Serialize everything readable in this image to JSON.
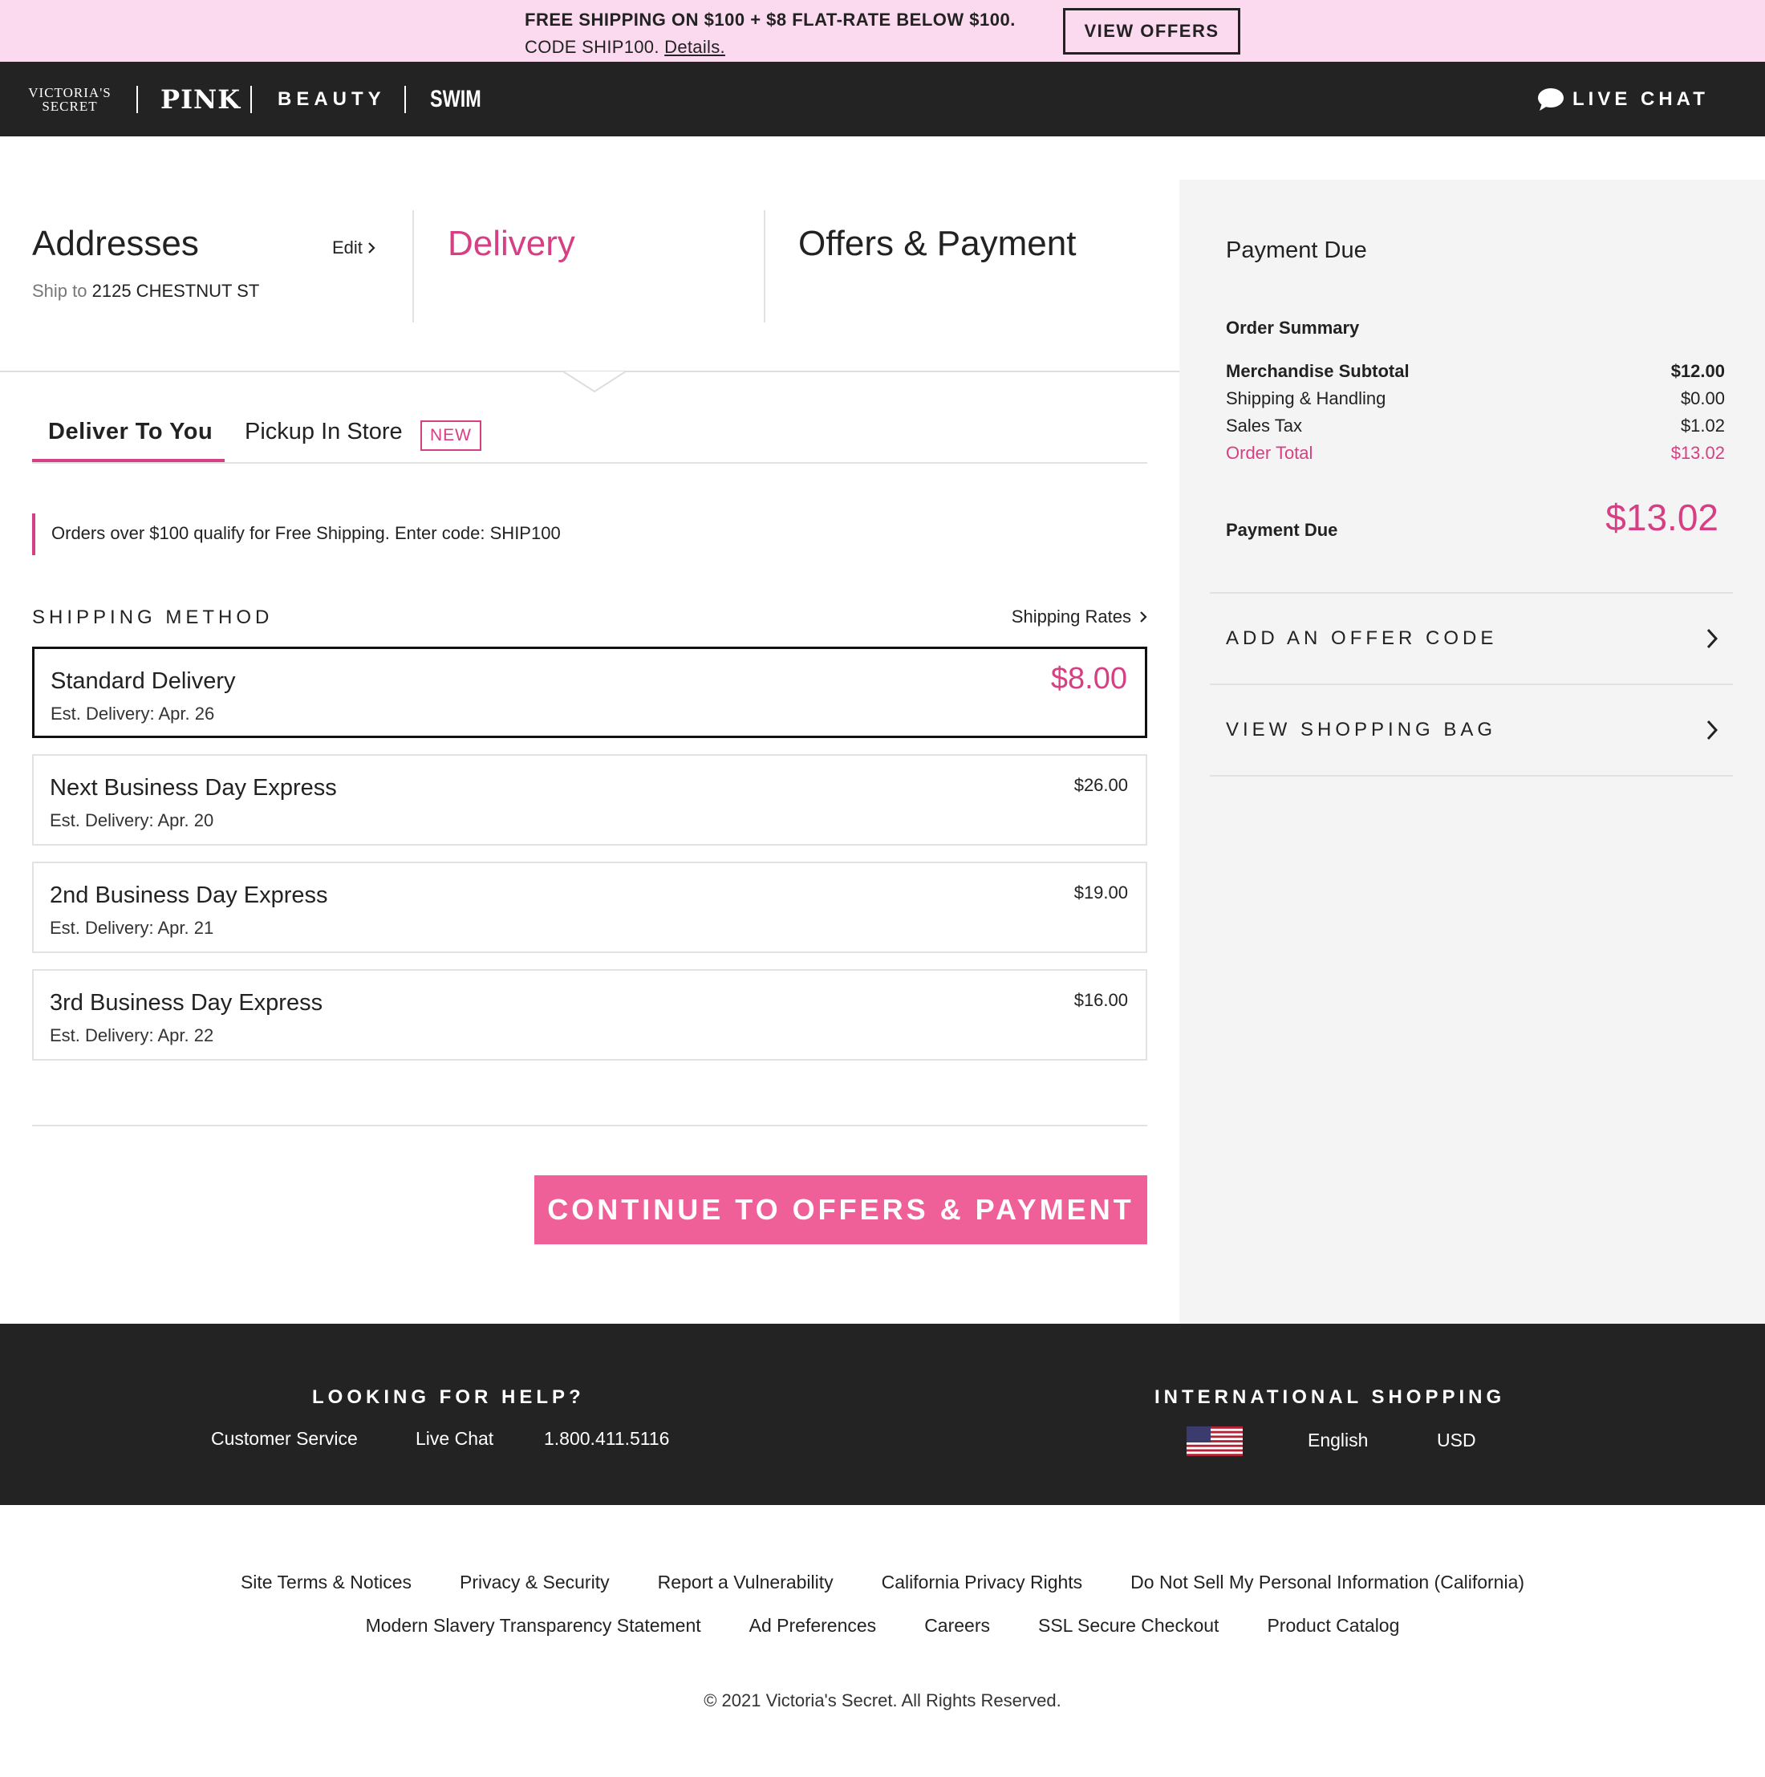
{
  "promo": {
    "line1": "FREE SHIPPING ON $100 + $8 FLAT-RATE BELOW $100.",
    "line2_prefix": "CODE SHIP100.",
    "details_link": "Details.",
    "button": "VIEW OFFERS",
    "background_color": "#fbd9ee"
  },
  "nav": {
    "brand_vs_line1": "VICTORIA'S",
    "brand_vs_line2": "SECRET",
    "brand_pink": "PINK",
    "brand_beauty": "BEAUTY",
    "brand_swim": "SWIM",
    "live_chat": "LIVE CHAT",
    "live_chat_icon": "chat-bubble-icon",
    "background_color": "#232323"
  },
  "steps": {
    "addresses": "Addresses",
    "edit": "Edit",
    "ship_to_label": "Ship to",
    "ship_to_address": "2125 CHESTNUT ST",
    "delivery": "Delivery",
    "offers_payment": "Offers & Payment",
    "active_color": "#d63f83"
  },
  "tabs": {
    "deliver_to_you": "Deliver To You",
    "pickup_in_store": "Pickup In Store",
    "new_badge": "NEW",
    "active": "Deliver To You"
  },
  "note": {
    "text": "Orders over $100 qualify for Free Shipping. Enter code: SHIP100"
  },
  "shipping": {
    "title": "SHIPPING METHOD",
    "rates_link": "Shipping Rates",
    "options": [
      {
        "name": "Standard Delivery",
        "est": "Est. Delivery: Apr. 26",
        "price": "$8.00",
        "selected": true
      },
      {
        "name": "Next Business Day Express",
        "est": "Est. Delivery: Apr. 20",
        "price": "$26.00",
        "selected": false
      },
      {
        "name": "2nd Business Day Express",
        "est": "Est. Delivery: Apr. 21",
        "price": "$19.00",
        "selected": false
      },
      {
        "name": "3rd Business Day Express",
        "est": "Est. Delivery: Apr. 22",
        "price": "$16.00",
        "selected": false
      }
    ],
    "continue_button": "CONTINUE TO OFFERS & PAYMENT",
    "button_color": "#ef5f98"
  },
  "sidebar": {
    "title": "Payment Due",
    "order_summary_title": "Order Summary",
    "rows": [
      {
        "label": "Merchandise Subtotal",
        "value": "$12.00"
      },
      {
        "label": "Shipping & Handling",
        "value": "$0.00"
      },
      {
        "label": "Sales Tax",
        "value": "$1.02"
      },
      {
        "label": "Order Total",
        "value": "$13.02"
      }
    ],
    "payment_due_label": "Payment Due",
    "payment_due_amount": "$13.02",
    "add_offer_code": "ADD AN OFFER CODE",
    "view_shopping_bag": "VIEW SHOPPING BAG"
  },
  "footer": {
    "help_title": "LOOKING FOR HELP?",
    "customer_service": "Customer Service",
    "live_chat": "Live Chat",
    "phone": "1.800.411.5116",
    "intl_title": "INTERNATIONAL SHOPPING",
    "flag_icon": "us-flag-icon",
    "language": "English",
    "currency": "USD"
  },
  "legal": {
    "row1": [
      "Site Terms & Notices",
      "Privacy & Security",
      "Report a Vulnerability",
      "California Privacy Rights",
      "Do Not Sell My Personal Information (California)"
    ],
    "row2": [
      "Modern Slavery Transparency Statement",
      "Ad Preferences",
      "Careers",
      "SSL Secure Checkout",
      "Product Catalog"
    ],
    "copyright": "© 2021 Victoria's Secret. All Rights Reserved."
  }
}
